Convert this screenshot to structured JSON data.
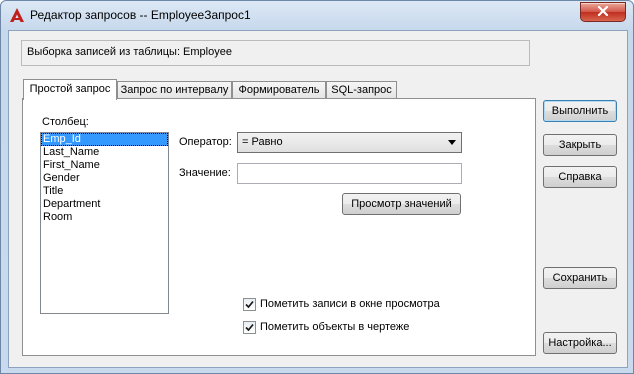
{
  "window": {
    "title": "Редактор запросов -- EmployeeЗапрос1",
    "close_icon": "close-icon",
    "app_icon": "autocad-red-a-icon"
  },
  "info": {
    "text": "Выборка записей из таблицы:  Employee"
  },
  "tabs": [
    {
      "label": "Простой запрос",
      "active": true
    },
    {
      "label": "Запрос по интервалу",
      "active": false
    },
    {
      "label": "Формирователь",
      "active": false
    },
    {
      "label": "SQL-запрос",
      "active": false
    }
  ],
  "simple_query": {
    "column_label": "Столбец:",
    "columns": [
      "Emp_Id",
      "Last_Name",
      "First_Name",
      "Gender",
      "Title",
      "Department",
      "Room"
    ],
    "selected_column": "Emp_Id",
    "operator_label": "Оператор:",
    "operator_value": "=   Равно",
    "value_label": "Значение:",
    "value_text": "",
    "browse_button": "Просмотр значений",
    "check_highlight_label": "Пометить записи в окне просмотра",
    "check_highlight_checked": true,
    "check_objects_label": "Пометить объекты в чертеже",
    "check_objects_checked": true
  },
  "side_buttons": {
    "execute": "Выполнить",
    "close": "Закрыть",
    "help": "Справка",
    "save": "Сохранить",
    "settings": "Настройка..."
  },
  "colors": {
    "accent_selection": "#3399ff",
    "close_button": "#c8392b",
    "frame": "#c9daee"
  }
}
